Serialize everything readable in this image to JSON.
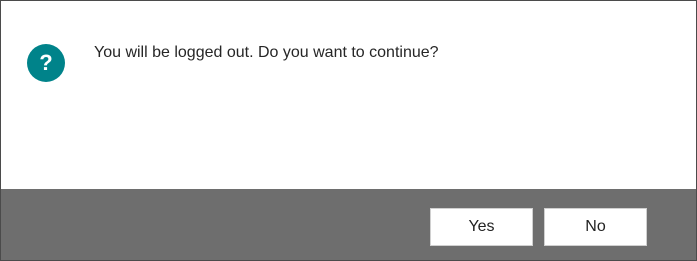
{
  "dialog": {
    "icon": "question-icon",
    "icon_glyph": "?",
    "message": "You will be logged out. Do you want to continue?",
    "buttons": {
      "yes_label": "Yes",
      "no_label": "No"
    },
    "colors": {
      "icon_background": "#00838a",
      "button_bar": "#6e6e6e",
      "message_background": "#ffffff"
    }
  }
}
